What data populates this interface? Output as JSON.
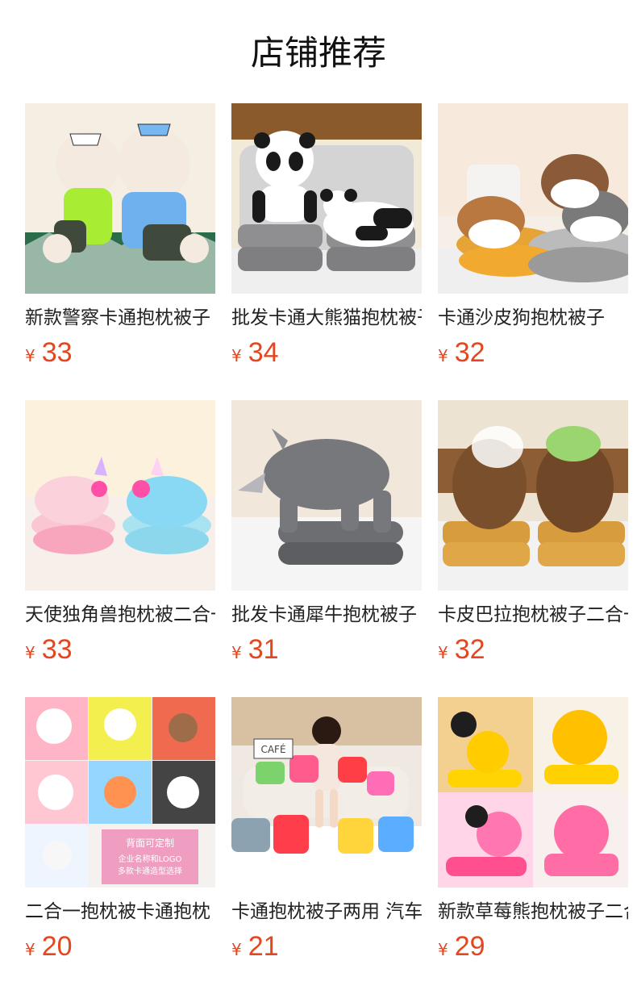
{
  "page": {
    "title": "店铺推荐"
  },
  "products": [
    {
      "name": "新款警察卡通抱枕被子",
      "currency": "¥",
      "price": "33",
      "icon": "police-bear-plush-image",
      "colors": {
        "bg": "#f4eee3",
        "base": "#3f4a3c",
        "item": "#f4eadf"
      }
    },
    {
      "name": "批发卡通大熊猫抱枕被子",
      "currency": "¥",
      "price": "34",
      "icon": "panda-plush-image",
      "colors": {
        "bg": "#f2ead9",
        "base": "#8f8f92",
        "item": "#1a1a1a"
      }
    },
    {
      "name": "卡通沙皮狗抱枕被子",
      "currency": "¥",
      "price": "32",
      "icon": "shar-pei-dog-plush-image",
      "colors": {
        "bg": "#f5efe7",
        "base": "#e7a436",
        "item": "#b9783f"
      }
    },
    {
      "name": "天使独角兽抱枕被二合一",
      "currency": "¥",
      "price": "33",
      "icon": "unicorn-plush-image",
      "colors": {
        "bg": "#fbf1dc",
        "base": "#f9c6d1",
        "item": "#a9e2f1"
      }
    },
    {
      "name": "批发卡通犀牛抱枕被子",
      "currency": "¥",
      "price": "31",
      "icon": "rhino-plush-image",
      "colors": {
        "bg": "#f1e7db",
        "base": "#6d6e72",
        "item": "#77787c"
      }
    },
    {
      "name": "卡皮巴拉抱枕被子二合一",
      "currency": "¥",
      "price": "32",
      "icon": "capybara-plush-image",
      "colors": {
        "bg": "#ece3d2",
        "base": "#d79c3e",
        "item": "#7a4f2b"
      }
    },
    {
      "name": "二合一抱枕被卡通抱枕",
      "currency": "¥",
      "price": "20",
      "icon": "pillow-blanket-collage-image",
      "colors": {
        "bg": "#f4f1ee",
        "base": "#ff9fb5",
        "item": "#8fd3ff"
      },
      "overlay": {
        "line1": "背面可定制",
        "line2": "企业名称和LOGO",
        "line3": "多款卡通造型选择"
      }
    },
    {
      "name": "卡通抱枕被子两用 汽车",
      "currency": "¥",
      "price": "21",
      "icon": "model-with-pillows-image",
      "colors": {
        "bg": "#efe9e2",
        "base": "#f2ede7",
        "item": "#ff5866"
      },
      "overlay": {
        "sign": "CAFÉ"
      }
    },
    {
      "name": "新款草莓熊抱枕被子二合一",
      "currency": "¥",
      "price": "29",
      "icon": "strawberry-bear-plush-image",
      "colors": {
        "bg": "#f8f3ea",
        "base": "#ffd400",
        "item": "#ff6fa8"
      }
    }
  ]
}
